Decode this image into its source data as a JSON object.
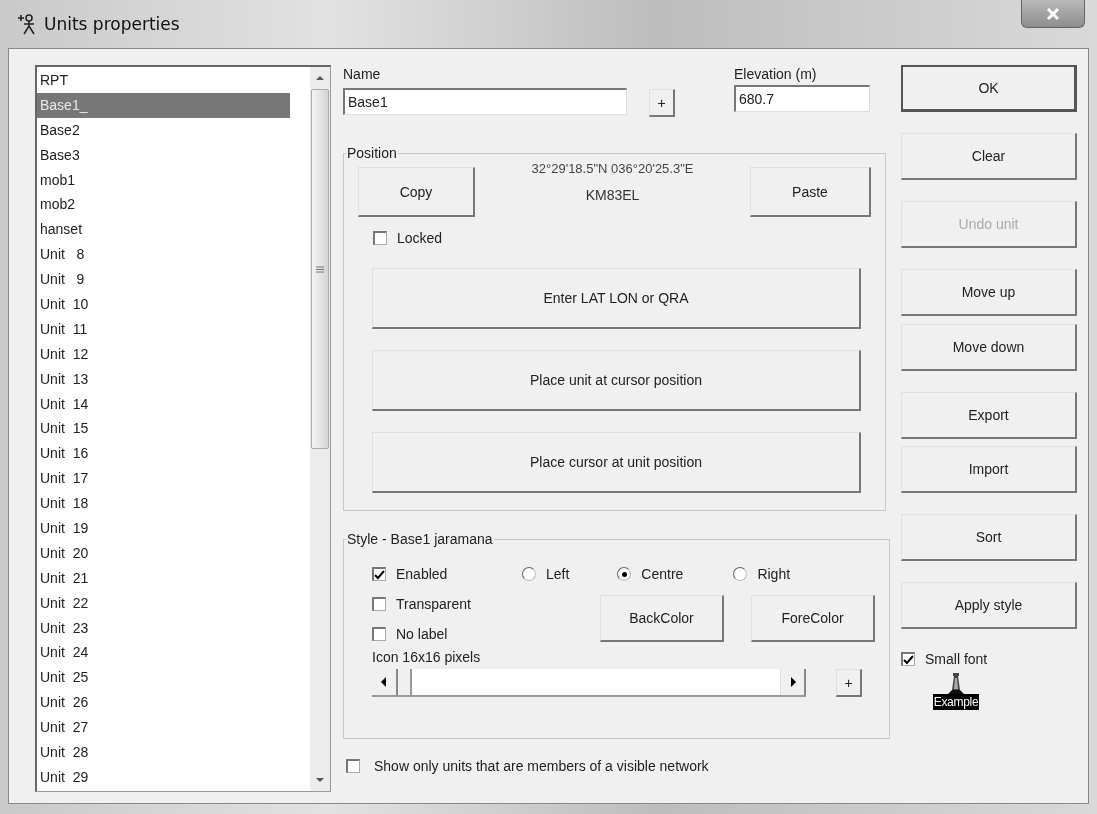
{
  "window": {
    "title": "Units properties"
  },
  "unit_list": {
    "items": [
      {
        "label": "RPT",
        "selected": false
      },
      {
        "label": "Base1_",
        "selected": true
      },
      {
        "label": "Base2",
        "selected": false
      },
      {
        "label": "Base3",
        "selected": false
      },
      {
        "label": "mob1",
        "selected": false
      },
      {
        "label": "mob2",
        "selected": false
      },
      {
        "label": "hanset",
        "selected": false
      },
      {
        "label": "Unit   8",
        "selected": false
      },
      {
        "label": "Unit   9",
        "selected": false
      },
      {
        "label": "Unit  10",
        "selected": false
      },
      {
        "label": "Unit  11",
        "selected": false
      },
      {
        "label": "Unit  12",
        "selected": false
      },
      {
        "label": "Unit  13",
        "selected": false
      },
      {
        "label": "Unit  14",
        "selected": false
      },
      {
        "label": "Unit  15",
        "selected": false
      },
      {
        "label": "Unit  16",
        "selected": false
      },
      {
        "label": "Unit  17",
        "selected": false
      },
      {
        "label": "Unit  18",
        "selected": false
      },
      {
        "label": "Unit  19",
        "selected": false
      },
      {
        "label": "Unit  20",
        "selected": false
      },
      {
        "label": "Unit  21",
        "selected": false
      },
      {
        "label": "Unit  22",
        "selected": false
      },
      {
        "label": "Unit  23",
        "selected": false
      },
      {
        "label": "Unit  24",
        "selected": false
      },
      {
        "label": "Unit  25",
        "selected": false
      },
      {
        "label": "Unit  26",
        "selected": false
      },
      {
        "label": "Unit  27",
        "selected": false
      },
      {
        "label": "Unit  28",
        "selected": false
      },
      {
        "label": "Unit  29",
        "selected": false
      }
    ]
  },
  "name": {
    "label": "Name",
    "value": "Base1",
    "add_button": "+"
  },
  "elevation": {
    "label": "Elevation (m)",
    "value": "680.7"
  },
  "position": {
    "title": "Position",
    "coordinates": "32°29'18.5\"N 036°20'25.3\"E",
    "locator": "KM83EL",
    "copy_button": "Copy",
    "paste_button": "Paste",
    "locked": {
      "label": "Locked",
      "checked": false
    },
    "buttons": [
      "Enter LAT LON or QRA",
      "Place unit at cursor position",
      "Place cursor at unit position"
    ]
  },
  "style": {
    "title": "Style - Base1 jaramana",
    "checkboxes": [
      {
        "label": "Enabled",
        "checked": true
      },
      {
        "label": "Transparent",
        "checked": false
      },
      {
        "label": "No label",
        "checked": false
      }
    ],
    "alignment": [
      {
        "label": "Left",
        "selected": false
      },
      {
        "label": "Centre",
        "selected": true
      },
      {
        "label": "Right",
        "selected": false
      }
    ],
    "back_color_button": "BackColor",
    "fore_color_button": "ForeColor",
    "icon_size": {
      "label": "Icon 16x16 pixels"
    },
    "add_icon_button": "+"
  },
  "show_only": {
    "label": "Show only units that are members of a visible network",
    "checked": false
  },
  "side_buttons": [
    {
      "label": "OK",
      "disabled": false,
      "default": true
    },
    {
      "label": "Clear",
      "disabled": false,
      "default": false
    },
    {
      "label": "Undo unit",
      "disabled": true,
      "default": false
    },
    {
      "label": "Move up",
      "disabled": false,
      "default": false
    },
    {
      "label": "Move down",
      "disabled": false,
      "default": false
    },
    {
      "label": "Export",
      "disabled": false,
      "default": false
    },
    {
      "label": "Import",
      "disabled": false,
      "default": false
    },
    {
      "label": "Sort",
      "disabled": false,
      "default": false
    },
    {
      "label": "Apply style",
      "disabled": false,
      "default": false
    }
  ],
  "small_font": {
    "label": "Small font",
    "checked": true
  },
  "example": {
    "label": "Example"
  }
}
